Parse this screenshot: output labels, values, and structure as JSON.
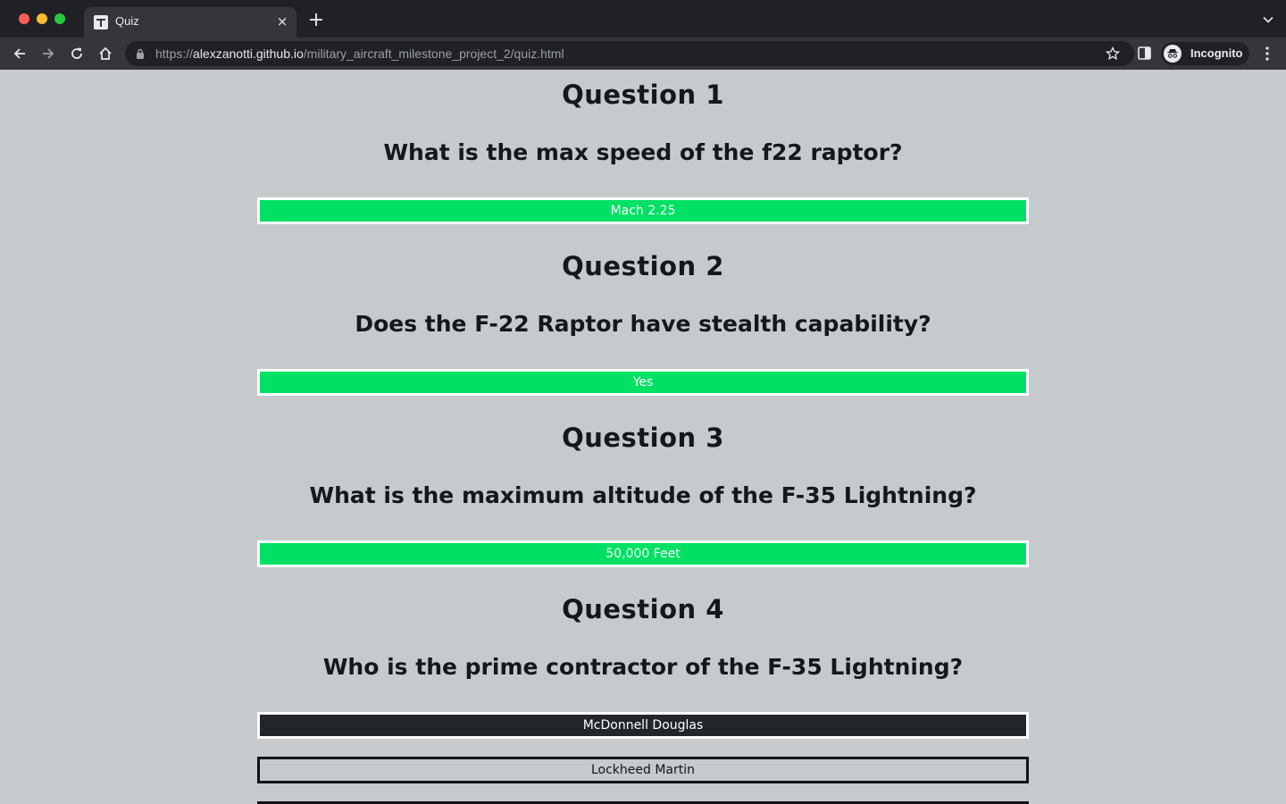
{
  "browser": {
    "tab_title": "Quiz",
    "url_prefix": "https://",
    "url_host": "alexzanotti.github.io",
    "url_path": "/military_aircraft_milestone_project_2/quiz.html",
    "profile_label": "Incognito"
  },
  "questions": [
    {
      "heading": "Question 1",
      "text": "What is the max speed of the f22 raptor?",
      "answers": [
        {
          "label": "Mach 2.25",
          "state": "correct"
        }
      ]
    },
    {
      "heading": "Question 2",
      "text": "Does the F-22 Raptor have stealth capability?",
      "answers": [
        {
          "label": "Yes",
          "state": "correct"
        }
      ]
    },
    {
      "heading": "Question 3",
      "text": "What is the maximum altitude of the F-35 Lightning?",
      "answers": [
        {
          "label": "50,000 Feet",
          "state": "correct"
        }
      ]
    },
    {
      "heading": "Question 4",
      "text": "Who is the prime contractor of the F-35 Lightning?",
      "answers": [
        {
          "label": "McDonnell Douglas",
          "state": "hover"
        },
        {
          "label": "Lockheed Martin",
          "state": "default"
        }
      ]
    }
  ],
  "colors": {
    "page_background": "#c6cacd",
    "correct_answer": "#00e064",
    "hover_answer": "#22262a",
    "browser_frame": "#202124"
  }
}
